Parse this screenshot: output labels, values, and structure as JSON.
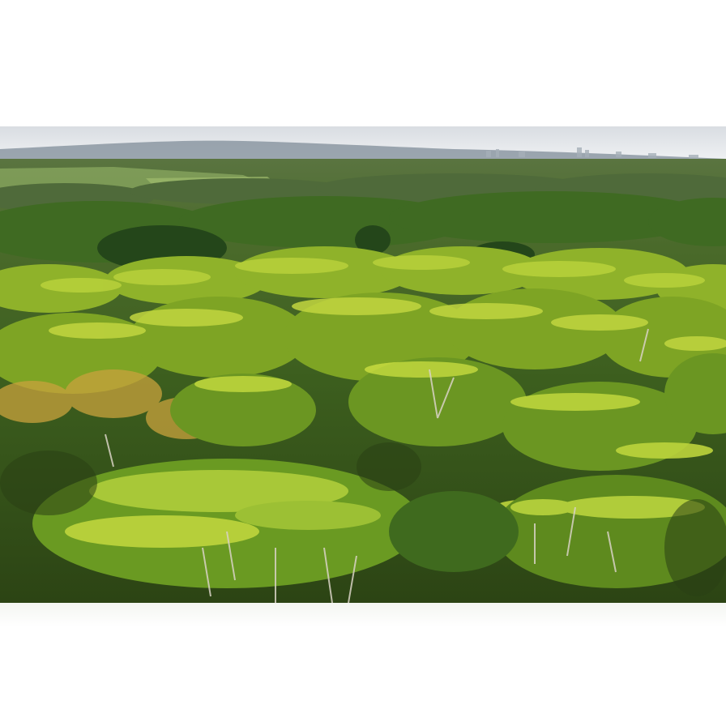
{
  "image": {
    "scene": "aerial-forest-canopy",
    "colors": {
      "sky_top": "#d9dde2",
      "sky_bottom": "#eef0f2",
      "far_hills": "#7f8c98",
      "distant_forest": "#4f6a3a",
      "mid_forest": "#3f6a22",
      "canopy_light": "#b6cf3a",
      "canopy_mid": "#8fb22a",
      "canopy_dark": "#4a7a1c",
      "autumn_tint": "#c9a23c",
      "shadow": "#2a3f14",
      "trunk": "#d8d2c4"
    }
  }
}
